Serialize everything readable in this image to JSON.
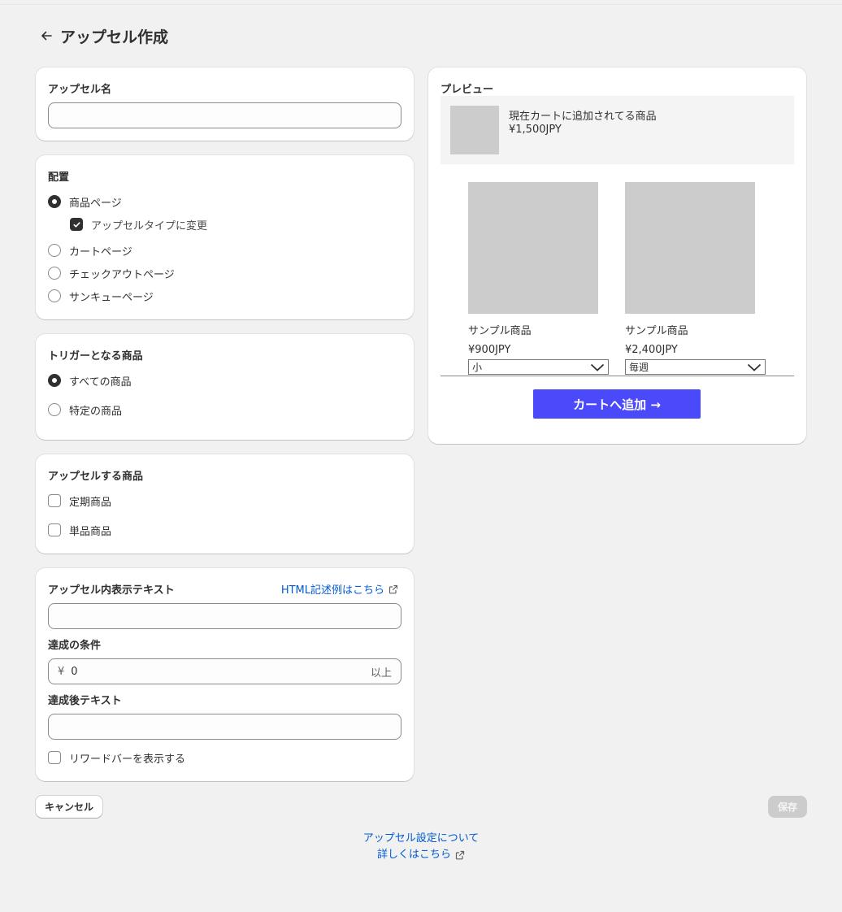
{
  "header": {
    "title": "アップセル作成"
  },
  "name_card": {
    "title": "アップセル名",
    "value": ""
  },
  "placement": {
    "title": "配置",
    "options": [
      {
        "label": "商品ページ",
        "selected": true
      },
      {
        "label": "カートページ",
        "selected": false
      },
      {
        "label": "チェックアウトページ",
        "selected": false
      },
      {
        "label": "サンキューページ",
        "selected": false
      }
    ],
    "sub_option": {
      "label": "アップセルタイプに変更",
      "checked": true
    }
  },
  "trigger": {
    "title": "トリガーとなる商品",
    "options": [
      {
        "label": "すべての商品",
        "selected": true
      },
      {
        "label": "特定の商品",
        "selected": false
      }
    ]
  },
  "upsell_products": {
    "title": "アップセルする商品",
    "options": [
      {
        "label": "定期商品",
        "checked": false
      },
      {
        "label": "単品商品",
        "checked": false
      }
    ]
  },
  "display_text": {
    "title": "アップセル内表示テキスト",
    "link": "HTML記述例はこちら",
    "value": "",
    "condition_title": "達成の条件",
    "condition_prefix": "¥",
    "condition_value": "0",
    "condition_suffix": "以上",
    "after_title": "達成後テキスト",
    "after_value": "",
    "reward_bar_label": "リワードバーを表示する",
    "reward_bar_checked": false
  },
  "actions": {
    "cancel": "キャンセル",
    "save": "保存"
  },
  "footer": {
    "line1": "アップセル設定について",
    "line2": "詳しくはこちら"
  },
  "preview": {
    "title": "プレビュー",
    "cart_item": {
      "name": "現在カートに追加されてる商品",
      "price": "¥1,500JPY"
    },
    "products": [
      {
        "name": "サンプル商品",
        "price": "¥900JPY",
        "option": "小"
      },
      {
        "name": "サンプル商品",
        "price": "¥2,400JPY",
        "option": "毎週"
      }
    ],
    "add_button": "カートへ追加 →"
  },
  "colors": {
    "accent_link": "#005bd3",
    "preview_button": "#4a4afa",
    "placeholder": "#cccccc"
  }
}
